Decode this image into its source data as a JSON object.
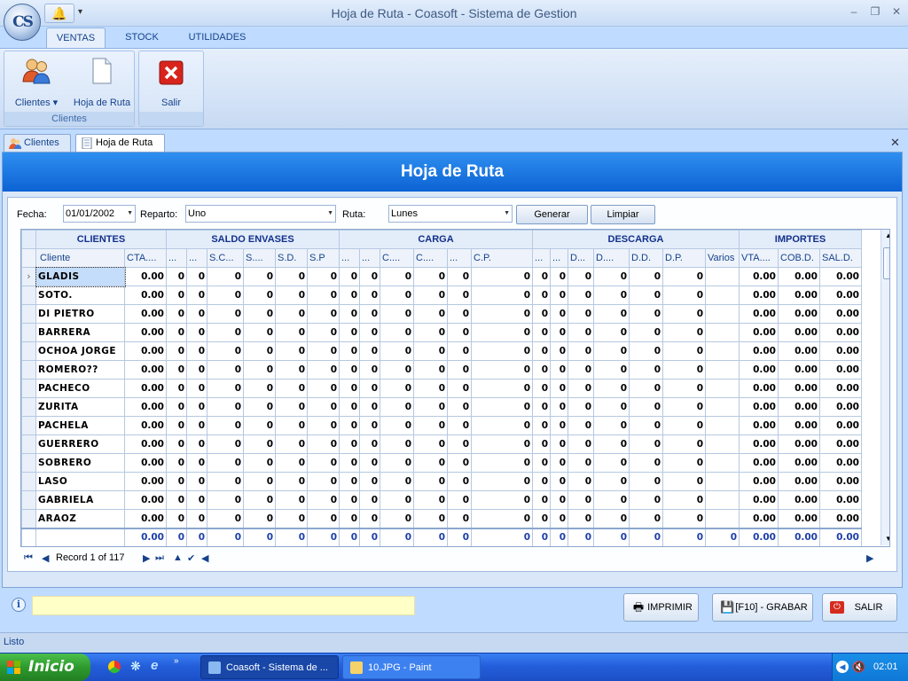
{
  "window": {
    "title": "Hoja de Ruta - Coasoft - Sistema de Gestion",
    "logo_text": "CS"
  },
  "ribbon": {
    "tabs": [
      {
        "label": "VENTAS",
        "active": true
      },
      {
        "label": "STOCK",
        "active": false
      },
      {
        "label": "UTILIDADES",
        "active": false
      }
    ],
    "group_clientes": {
      "label": "Clientes",
      "btn_clientes": "Clientes ▾",
      "btn_hoja": "Hoja de Ruta"
    },
    "btn_salir": "Salir"
  },
  "doc_tabs": [
    "Clientes",
    "Hoja de Ruta"
  ],
  "page": {
    "header": "Hoja de Ruta",
    "filters": {
      "fecha_label": "Fecha:",
      "fecha_value": "01/01/2002",
      "reparto_label": "Reparto:",
      "reparto_value": "Uno",
      "ruta_label": "Ruta:",
      "ruta_value": "Lunes",
      "generar": "Generar",
      "limpiar": "Limpiar"
    }
  },
  "grid": {
    "bands": [
      "CLIENTES",
      "SALDO ENVASES",
      "CARGA",
      "DESCARGA",
      "IMPORTES"
    ],
    "columns": [
      "Cliente",
      "CTA....",
      "...",
      "...",
      "S.C...",
      "S....",
      "S.D.",
      "S.P",
      "...",
      "...",
      "C....",
      "C....",
      "...",
      "C.P.",
      "...",
      "...",
      "D...",
      "D....",
      "D.D.",
      "D.P.",
      "Varios",
      "VTA....",
      "COB.D.",
      "SAL.D."
    ],
    "rows": [
      [
        "GLADIS",
        "0.00",
        "0",
        "0",
        "0",
        "0",
        "0",
        "0",
        "0",
        "0",
        "0",
        "0",
        "0",
        "0",
        "0",
        "0",
        "0",
        "0",
        "0",
        "0",
        "",
        "0.00",
        "0.00",
        "0.00"
      ],
      [
        "SOTO.",
        "0.00",
        "0",
        "0",
        "0",
        "0",
        "0",
        "0",
        "0",
        "0",
        "0",
        "0",
        "0",
        "0",
        "0",
        "0",
        "0",
        "0",
        "0",
        "0",
        "",
        "0.00",
        "0.00",
        "0.00"
      ],
      [
        "DI PIETRO",
        "0.00",
        "0",
        "0",
        "0",
        "0",
        "0",
        "0",
        "0",
        "0",
        "0",
        "0",
        "0",
        "0",
        "0",
        "0",
        "0",
        "0",
        "0",
        "0",
        "",
        "0.00",
        "0.00",
        "0.00"
      ],
      [
        "BARRERA",
        "0.00",
        "0",
        "0",
        "0",
        "0",
        "0",
        "0",
        "0",
        "0",
        "0",
        "0",
        "0",
        "0",
        "0",
        "0",
        "0",
        "0",
        "0",
        "0",
        "",
        "0.00",
        "0.00",
        "0.00"
      ],
      [
        "OCHOA JORGE",
        "0.00",
        "0",
        "0",
        "0",
        "0",
        "0",
        "0",
        "0",
        "0",
        "0",
        "0",
        "0",
        "0",
        "0",
        "0",
        "0",
        "0",
        "0",
        "0",
        "",
        "0.00",
        "0.00",
        "0.00"
      ],
      [
        "ROMERO??",
        "0.00",
        "0",
        "0",
        "0",
        "0",
        "0",
        "0",
        "0",
        "0",
        "0",
        "0",
        "0",
        "0",
        "0",
        "0",
        "0",
        "0",
        "0",
        "0",
        "",
        "0.00",
        "0.00",
        "0.00"
      ],
      [
        "PACHECO",
        "0.00",
        "0",
        "0",
        "0",
        "0",
        "0",
        "0",
        "0",
        "0",
        "0",
        "0",
        "0",
        "0",
        "0",
        "0",
        "0",
        "0",
        "0",
        "0",
        "",
        "0.00",
        "0.00",
        "0.00"
      ],
      [
        "ZURITA",
        "0.00",
        "0",
        "0",
        "0",
        "0",
        "0",
        "0",
        "0",
        "0",
        "0",
        "0",
        "0",
        "0",
        "0",
        "0",
        "0",
        "0",
        "0",
        "0",
        "",
        "0.00",
        "0.00",
        "0.00"
      ],
      [
        "PACHELA",
        "0.00",
        "0",
        "0",
        "0",
        "0",
        "0",
        "0",
        "0",
        "0",
        "0",
        "0",
        "0",
        "0",
        "0",
        "0",
        "0",
        "0",
        "0",
        "0",
        "",
        "0.00",
        "0.00",
        "0.00"
      ],
      [
        "GUERRERO",
        "0.00",
        "0",
        "0",
        "0",
        "0",
        "0",
        "0",
        "0",
        "0",
        "0",
        "0",
        "0",
        "0",
        "0",
        "0",
        "0",
        "0",
        "0",
        "0",
        "",
        "0.00",
        "0.00",
        "0.00"
      ],
      [
        "SOBRERO",
        "0.00",
        "0",
        "0",
        "0",
        "0",
        "0",
        "0",
        "0",
        "0",
        "0",
        "0",
        "0",
        "0",
        "0",
        "0",
        "0",
        "0",
        "0",
        "0",
        "",
        "0.00",
        "0.00",
        "0.00"
      ],
      [
        "LASO",
        "0.00",
        "0",
        "0",
        "0",
        "0",
        "0",
        "0",
        "0",
        "0",
        "0",
        "0",
        "0",
        "0",
        "0",
        "0",
        "0",
        "0",
        "0",
        "0",
        "",
        "0.00",
        "0.00",
        "0.00"
      ],
      [
        "GABRIELA",
        "0.00",
        "0",
        "0",
        "0",
        "0",
        "0",
        "0",
        "0",
        "0",
        "0",
        "0",
        "0",
        "0",
        "0",
        "0",
        "0",
        "0",
        "0",
        "0",
        "",
        "0.00",
        "0.00",
        "0.00"
      ],
      [
        "ARAOZ",
        "0.00",
        "0",
        "0",
        "0",
        "0",
        "0",
        "0",
        "0",
        "0",
        "0",
        "0",
        "0",
        "0",
        "0",
        "0",
        "0",
        "0",
        "0",
        "0",
        "",
        "0.00",
        "0.00",
        "0.00"
      ]
    ],
    "summary": [
      "",
      "0.00",
      "0",
      "0",
      "0",
      "0",
      "0",
      "0",
      "0",
      "0",
      "0",
      "0",
      "0",
      "0",
      "0",
      "0",
      "0",
      "0",
      "0",
      "0",
      "0",
      "0.00",
      "0.00",
      "0.00"
    ],
    "navigator_text": "Record 1 of 117"
  },
  "bottom": {
    "info_icon": "info-icon",
    "imprimir": "IMPRIMIR",
    "grabar": "[F10] - GRABAR",
    "salir": "SALIR"
  },
  "status": "Listo",
  "taskbar": {
    "start": "Inicio",
    "tasks": [
      "Coasoft - Sistema de ...",
      "10.JPG - Paint"
    ],
    "clock": "02:01"
  },
  "colors": {
    "header_band": "#1a75e6",
    "ribbon_bg": "#d1e1f6",
    "taskbar": "#245edb"
  }
}
